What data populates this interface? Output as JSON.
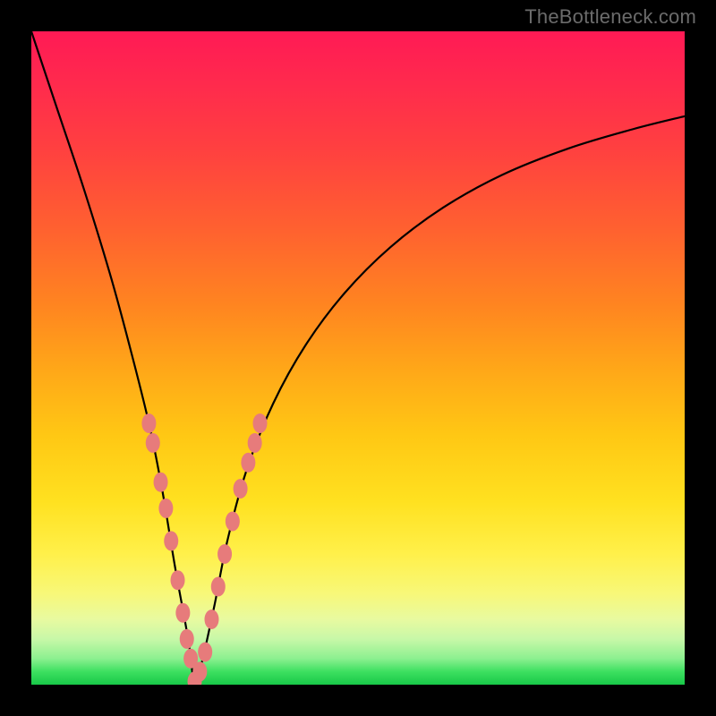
{
  "watermark": "TheBottleneck.com",
  "chart_data": {
    "type": "line",
    "title": "",
    "xlabel": "",
    "ylabel": "",
    "xlim": [
      0,
      100
    ],
    "ylim": [
      0,
      100
    ],
    "gradient_stops": [
      {
        "pos": 0,
        "color": "#ff1a55"
      },
      {
        "pos": 18,
        "color": "#ff4040"
      },
      {
        "pos": 42,
        "color": "#ff8520"
      },
      {
        "pos": 62,
        "color": "#ffc814"
      },
      {
        "pos": 80,
        "color": "#fff04a"
      },
      {
        "pos": 93,
        "color": "#c8f8a8"
      },
      {
        "pos": 100,
        "color": "#18c848"
      }
    ],
    "series": [
      {
        "name": "bottleneck-curve",
        "x": [
          0,
          4,
          8,
          12,
          15,
          18,
          20,
          22,
          24,
          25,
          26,
          28,
          30,
          33,
          37,
          42,
          48,
          55,
          63,
          72,
          82,
          92,
          100
        ],
        "y": [
          100,
          88,
          76,
          63,
          52,
          40,
          30,
          18,
          7,
          0,
          3,
          12,
          22,
          33,
          43,
          52,
          60,
          67,
          73,
          78,
          82,
          85,
          87
        ]
      }
    ],
    "markers": {
      "name": "highlight-dots",
      "color": "#e77b7b",
      "points": [
        {
          "x": 18.0,
          "y": 40
        },
        {
          "x": 18.6,
          "y": 37
        },
        {
          "x": 19.8,
          "y": 31
        },
        {
          "x": 20.6,
          "y": 27
        },
        {
          "x": 21.4,
          "y": 22
        },
        {
          "x": 22.4,
          "y": 16
        },
        {
          "x": 23.2,
          "y": 11
        },
        {
          "x": 23.8,
          "y": 7
        },
        {
          "x": 24.4,
          "y": 4
        },
        {
          "x": 25.0,
          "y": 0.5
        },
        {
          "x": 25.8,
          "y": 2
        },
        {
          "x": 26.6,
          "y": 5
        },
        {
          "x": 27.6,
          "y": 10
        },
        {
          "x": 28.6,
          "y": 15
        },
        {
          "x": 29.6,
          "y": 20
        },
        {
          "x": 30.8,
          "y": 25
        },
        {
          "x": 32.0,
          "y": 30
        },
        {
          "x": 33.2,
          "y": 34
        },
        {
          "x": 34.2,
          "y": 37
        },
        {
          "x": 35.0,
          "y": 40
        }
      ]
    }
  }
}
